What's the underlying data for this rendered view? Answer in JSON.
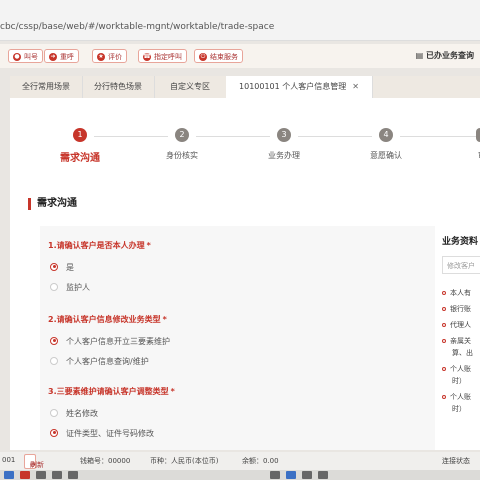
{
  "browser": {
    "url": "cbc/cssp/base/web/#/worktable-mgnt/worktable/trade-space"
  },
  "toolbar": {
    "buttons": [
      "叫号",
      "重呼",
      "评价",
      "指定呼叫",
      "结束服务"
    ],
    "right_label": "已办业务查询"
  },
  "tabs": [
    "全行常用场景",
    "分行特色场景",
    "自定义专区",
    "10100101 个人客户信息管理"
  ],
  "steps": [
    "需求沟通",
    "身份核实",
    "业务办理",
    "意愿确认",
    "审"
  ],
  "section_title": "需求沟通",
  "questions": [
    {
      "title": "1.请确认客户是否本人办理",
      "required": "*",
      "options": [
        "是",
        "监护人"
      ],
      "selected": 0
    },
    {
      "title": "2.请确认客户信息修改业务类型",
      "required": "*",
      "options": [
        "个人客户信息开立三要素维护",
        "个人客户信息查询/维护"
      ],
      "selected": 0
    },
    {
      "title": "3.三要素维护请确认客户调整类型",
      "required": "*",
      "options": [
        "姓名修改",
        "证件类型、证件号码修改"
      ],
      "selected": 1
    }
  ],
  "side_panel": {
    "title": "业务资料",
    "search_placeholder": "修改客户",
    "items": [
      "本人有",
      "银行账",
      "代理人",
      "亲属关",
      "算、出",
      "个人账",
      "时）",
      "个人账",
      "时）"
    ]
  },
  "statusbar": {
    "left": "001",
    "refresh": "刷新",
    "counter": "钱箱号：00000",
    "currency": "币种：人民币(本位币)",
    "balance": "余额：0.00",
    "conn": "连接状态"
  },
  "colors": {
    "accent": "#c7352a",
    "gray_step": "#8a8580"
  }
}
